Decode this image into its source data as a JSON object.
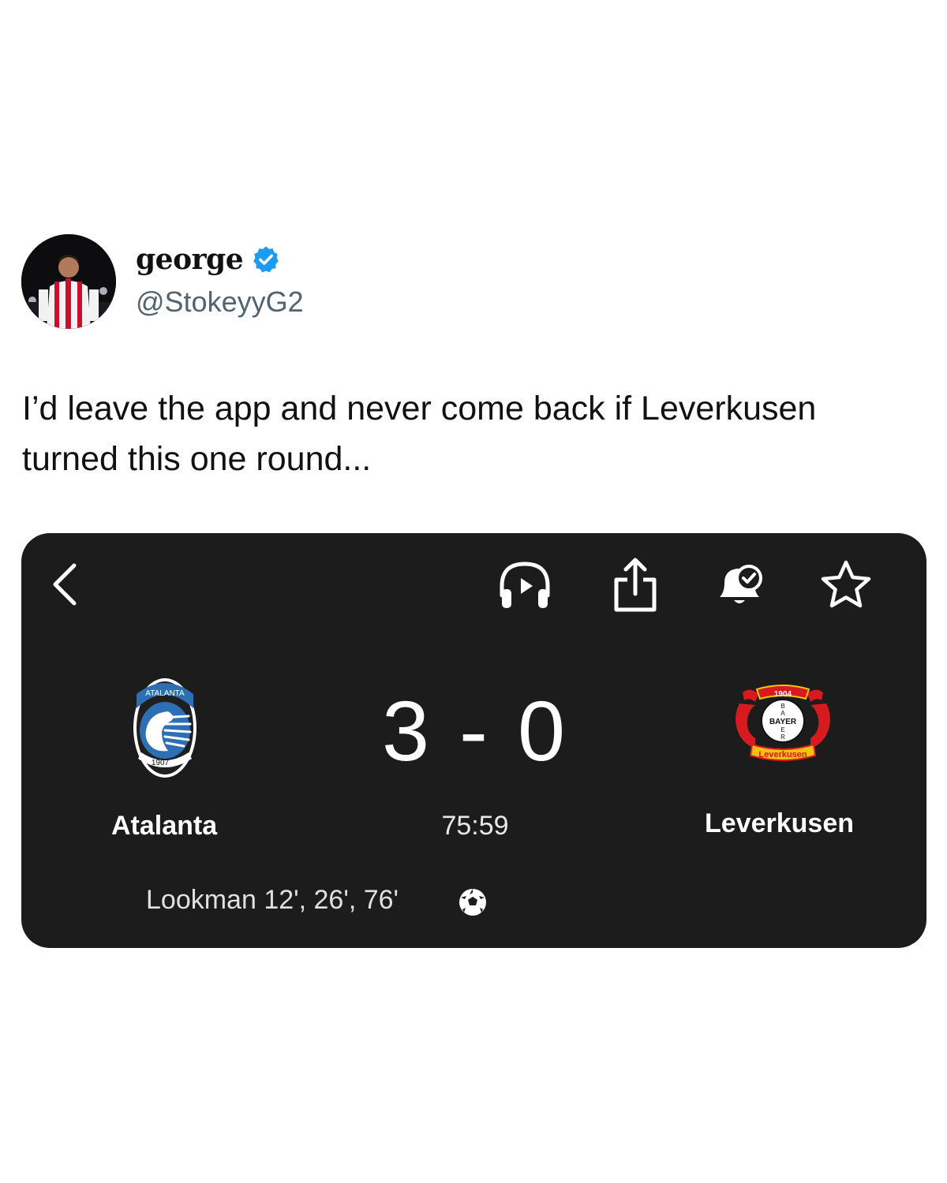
{
  "tweet": {
    "display_name": "george",
    "handle": "@StokeyyG2",
    "text": "I’d leave the app and never come back if Leverkusen turned this one round..."
  },
  "match_card": {
    "home_team": {
      "name": "Atalanta",
      "logo_text": "ATALANTA",
      "logo_year": "1907"
    },
    "away_team": {
      "name": "Leverkusen",
      "logo_top": "1904",
      "logo_center": "BAYER",
      "logo_bottom": "Leverkusen"
    },
    "score": "3 - 0",
    "clock": "75:59",
    "scorers": "Lookman 12', 26', 76'",
    "colors": {
      "background": "#1c1c1c",
      "text": "#ffffff",
      "verified": "#1d9bf0"
    },
    "icons": [
      "chevron-left-icon",
      "headphones-icon",
      "share-icon",
      "bell-check-icon",
      "star-icon",
      "soccer-ball-icon"
    ]
  }
}
